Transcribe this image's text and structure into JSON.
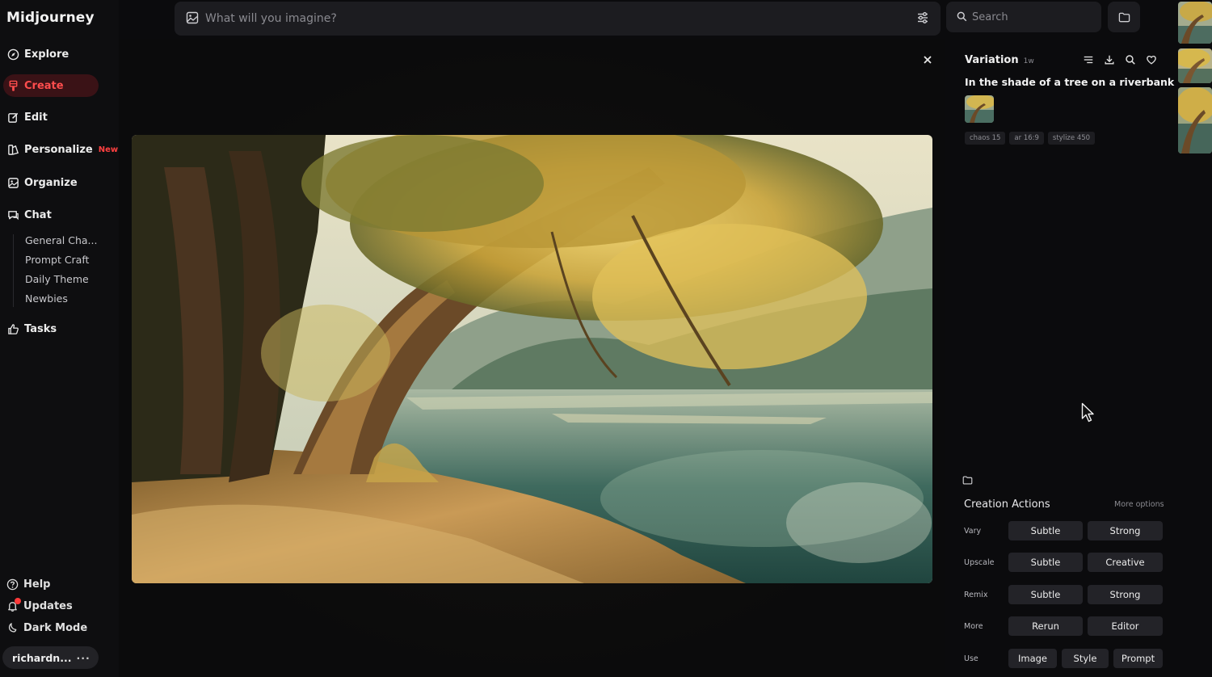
{
  "app": {
    "logo": "Midjourney"
  },
  "sidebar": {
    "nav": [
      {
        "label": "Explore",
        "icon": "compass-icon"
      },
      {
        "label": "Create",
        "icon": "brush-icon",
        "active": true
      },
      {
        "label": "Edit",
        "icon": "edit-icon"
      },
      {
        "label": "Personalize",
        "icon": "personalize-icon",
        "badge": "New!"
      },
      {
        "label": "Organize",
        "icon": "image-grid-icon"
      },
      {
        "label": "Chat",
        "icon": "chat-icon"
      }
    ],
    "chat_rooms": [
      "General Cha...",
      "Prompt Craft",
      "Daily Theme",
      "Newbies"
    ],
    "tasks": "Tasks",
    "bottom": {
      "help": "Help",
      "updates": "Updates",
      "dark_mode": "Dark Mode"
    },
    "user": {
      "name": "richardn...",
      "menu": "···"
    }
  },
  "topbar": {
    "prompt_placeholder": "What will you imagine?",
    "search_placeholder": "Search"
  },
  "detail": {
    "title": "Variation",
    "age": "1w",
    "prompt": "In the shade of a tree on a riverbank",
    "params": [
      "chaos 15",
      "ar 16:9",
      "stylize 450"
    ],
    "actions_title": "Creation Actions",
    "more_options": "More options",
    "rows": [
      {
        "label": "Vary",
        "buttons": [
          "Subtle",
          "Strong"
        ]
      },
      {
        "label": "Upscale",
        "buttons": [
          "Subtle",
          "Creative"
        ]
      },
      {
        "label": "Remix",
        "buttons": [
          "Subtle",
          "Strong"
        ]
      },
      {
        "label": "More",
        "buttons": [
          "Rerun",
          "Editor"
        ]
      },
      {
        "label": "Use",
        "buttons": [
          "Image",
          "Style",
          "Prompt"
        ]
      }
    ]
  },
  "colors": {
    "accent": "#ff4d4d",
    "active_bg": "#3a1216",
    "panel_bg": "#0b0b0d",
    "button_bg": "#232328"
  }
}
